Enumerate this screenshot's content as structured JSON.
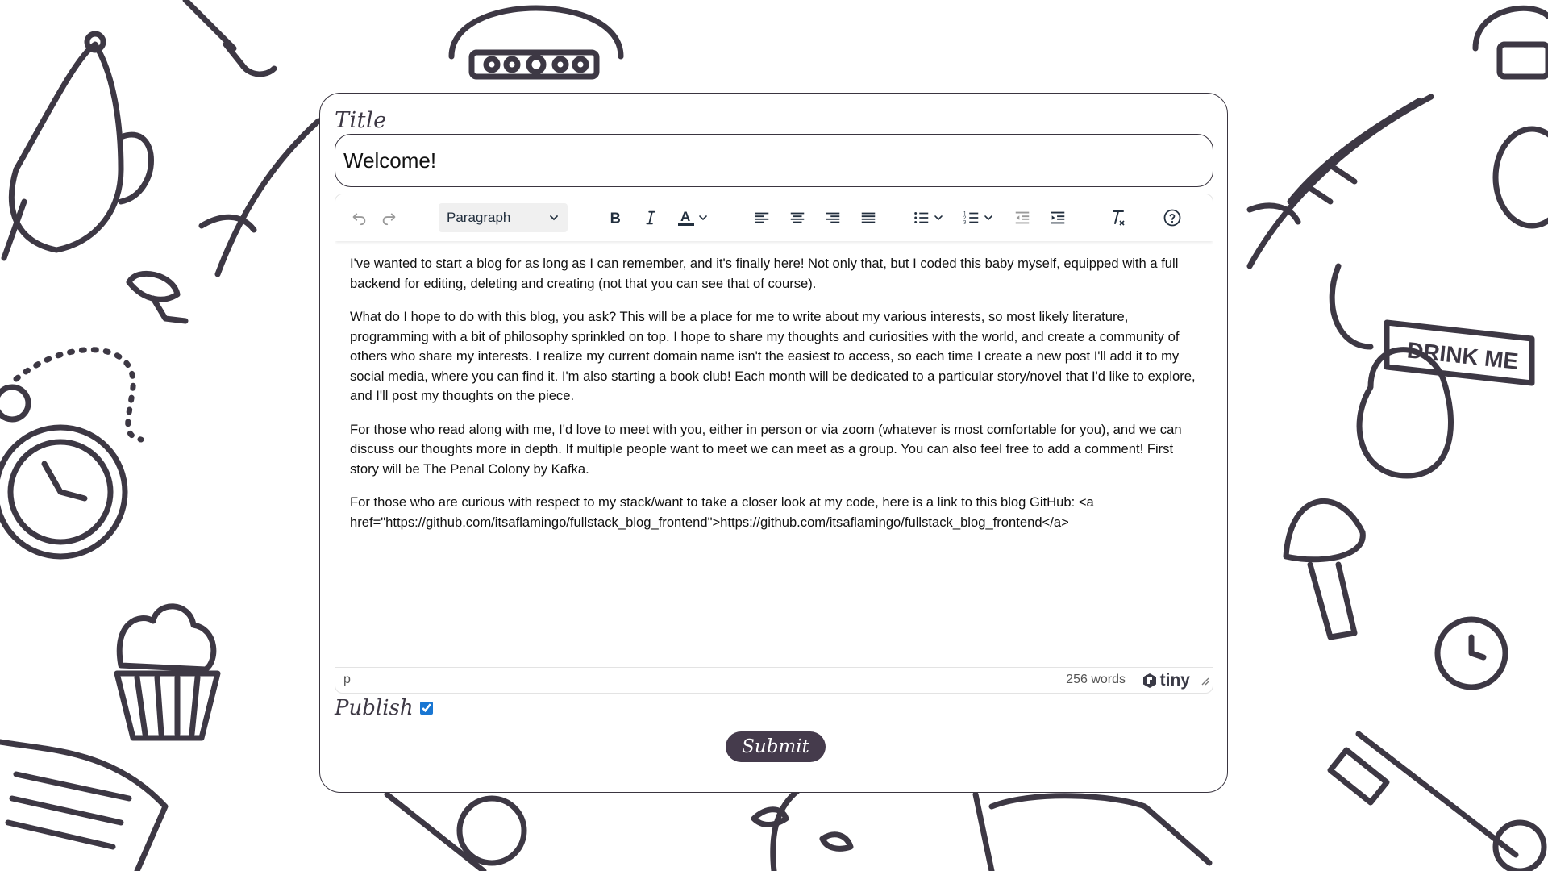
{
  "colors": {
    "ink": "#3d3844",
    "accent": "#453b4c",
    "checkbox": "#1976d2"
  },
  "form": {
    "title_label": "Title",
    "title_value": "Welcome!",
    "publish_label": "Publish",
    "publish_checked": true,
    "submit_label": "Submit"
  },
  "toolbar": {
    "block_format": "Paragraph",
    "icons": [
      "undo-icon",
      "redo-icon",
      "bold-icon",
      "italic-icon",
      "text-color-icon",
      "align-left-icon",
      "align-center-icon",
      "align-right-icon",
      "justify-icon",
      "bullet-list-icon",
      "numbered-list-icon",
      "outdent-icon",
      "indent-icon",
      "clear-formatting-icon",
      "help-icon"
    ]
  },
  "editor": {
    "paragraphs": [
      "I've wanted to start a blog for as long as I can remember, and it's finally here! Not only that, but I coded this baby myself, equipped with a full backend for editing, deleting and creating (not that you can see that of course).",
      "What do I hope to do with this blog, you ask? This will be a place for me to write about my various interests, so most likely literature, programming with a bit of philosophy sprinkled on top. I hope to share my thoughts and curiosities with the world, and create a community of others who share my interests. I realize my current domain name isn't the easiest to access, so each time I create a new post I'll add it to my social media, where you can find it. I'm also starting a book club! Each month will be dedicated to a particular story/novel that I'd like to explore, and I'll post my thoughts on the piece.",
      "For those who read along with me, I'd love to meet with you, either in person or via zoom (whatever is most comfortable for you), and we can discuss our thoughts more in depth. If multiple people want to meet we can meet as a group. You can also feel free to add a comment! First story will be The Penal Colony by Kafka.",
      "For those who are curious with respect to my stack/want to take a closer look at my code, here is a link to this blog GitHub: <a href=\"https://github.com/itsaflamingo/fullstack_blog_frontend\">https://github.com/itsaflamingo/fullstack_blog_frontend</a>"
    ]
  },
  "statusbar": {
    "path": "p",
    "word_count": "256 words",
    "brand": "tiny"
  },
  "background": {
    "banner_text": "DRINK ME"
  }
}
